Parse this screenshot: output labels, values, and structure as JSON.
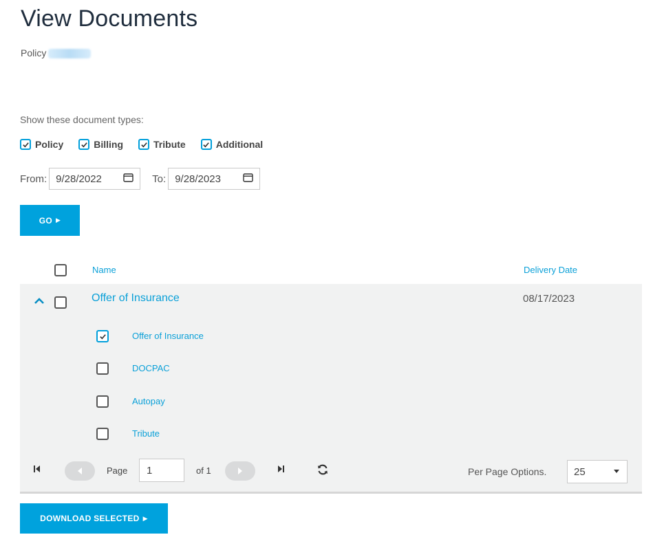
{
  "header": {
    "title": "View Documents",
    "policy_label": "Policy"
  },
  "filters": {
    "types_label": "Show these document types:",
    "types": [
      {
        "label": "Policy",
        "checked": true
      },
      {
        "label": "Billing",
        "checked": true
      },
      {
        "label": "Tribute",
        "checked": true
      },
      {
        "label": "Additional",
        "checked": true
      }
    ],
    "from_label": "From:",
    "from_date": "9/28/2022",
    "to_label": "To:",
    "to_date": "9/28/2023",
    "go_label": "GO"
  },
  "table": {
    "columns": {
      "name": "Name",
      "delivery_date": "Delivery Date"
    },
    "groups": [
      {
        "name": "Offer of Insurance",
        "delivery_date": "08/17/2023",
        "expanded": true,
        "checked": false,
        "items": [
          {
            "name": "Offer of Insurance",
            "checked": true
          },
          {
            "name": "DOCPAC",
            "checked": false
          },
          {
            "name": "Autopay",
            "checked": false
          },
          {
            "name": "Tribute",
            "checked": false
          }
        ]
      }
    ]
  },
  "pager": {
    "page_label": "Page",
    "current_page": "1",
    "of_label": "of 1",
    "per_page_label": "Per Page Options.",
    "per_page_value": "25"
  },
  "actions": {
    "download_label": "DOWNLOAD SELECTED"
  },
  "colors": {
    "accent": "#00a2dd",
    "link": "#0aa0d8",
    "group_bg": "#f1f2f2"
  }
}
